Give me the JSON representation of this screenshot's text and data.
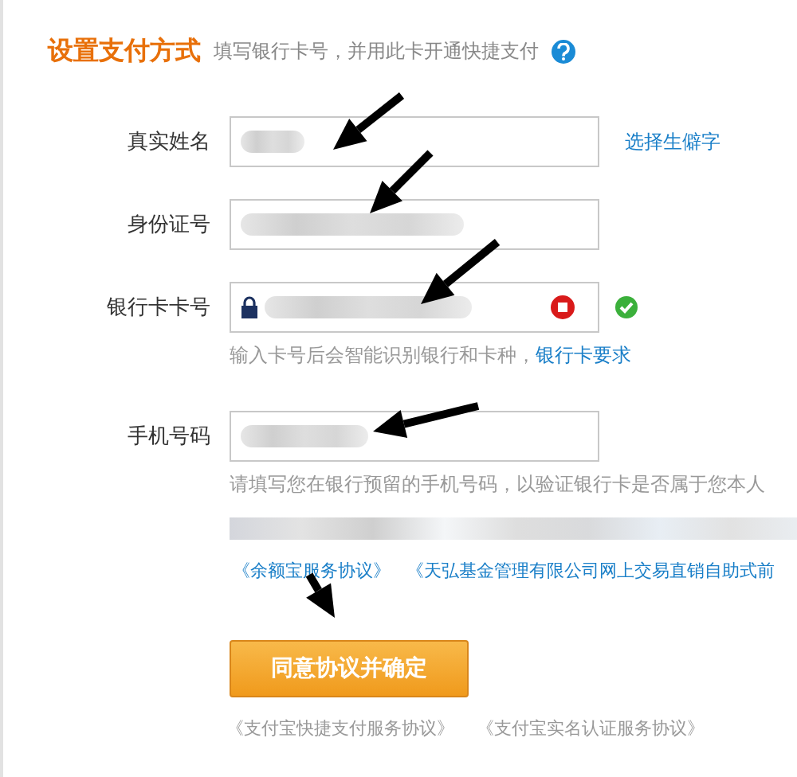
{
  "header": {
    "title": "设置支付方式",
    "subtitle": "填写银行卡号，并用此卡开通快捷支付"
  },
  "fields": [
    {
      "kind": "name",
      "label": "真实姓名",
      "link": "选择生僻字"
    },
    {
      "kind": "id",
      "label": "身份证号"
    },
    {
      "kind": "card",
      "label": "银行卡卡号",
      "valid": true,
      "hint": "输入卡号后会智能识别银行和卡种，",
      "hint_link": "银行卡要求"
    },
    {
      "kind": "phone",
      "label": "手机号码",
      "hint": "请填写您在银行预留的手机号码，以验证银行卡是否属于您本人"
    }
  ],
  "agreements": [
    "《余额宝服务协议》",
    "《天弘基金管理有限公司网上交易直销自助式前"
  ],
  "submit": "同意协议并确定",
  "bottom_links": [
    "《支付宝快捷支付服务协议》",
    "《支付宝实名认证服务协议》"
  ]
}
